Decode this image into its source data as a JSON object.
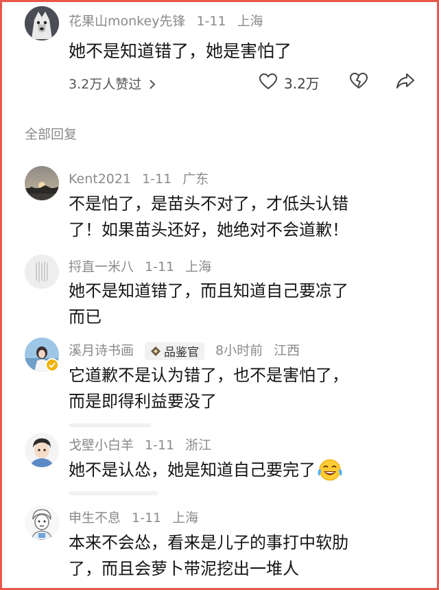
{
  "main_comment": {
    "username": "花果山monkey先锋",
    "date": "1-11",
    "location": "上海",
    "text": "她不是知道错了，她是害怕了",
    "likes_summary": "3.2万人赞过",
    "like_count": "3.2万"
  },
  "replies_header": "全部回复",
  "replies": [
    {
      "username": "Kent2021",
      "date": "1-11",
      "location": "广东",
      "line1": "不是怕了，是苗头不对了，才低头认错",
      "line2": "了！如果苗头还好，她绝对不会道歉！"
    },
    {
      "username": "捋直一米八",
      "date": "1-11",
      "location": "上海",
      "line1": "她不是知道错了，而且知道自己要凉了",
      "line2": "而已"
    },
    {
      "username": "溪月诗书画",
      "badge": "品鉴官",
      "date": "8小时前",
      "location": "江西",
      "line1": "它道歉不是认为错了，也不是害怕了，",
      "line2": "而是即得利益要没了"
    },
    {
      "username": "戈壁小白羊",
      "date": "1-11",
      "location": "浙江",
      "line1": "她不是认怂，她是知道自己要完了",
      "emoji": "tears-of-joy-emoji"
    },
    {
      "username": "申生不息",
      "date": "1-11",
      "location": "上海",
      "line1": "本来不会怂，看来是儿子的事打中软肋",
      "line2": "了，而且会萝卜带泥挖出一堆人"
    }
  ],
  "colors": {
    "frame": "#e8594b",
    "meta": "#8a8a8a",
    "text": "#151515"
  }
}
